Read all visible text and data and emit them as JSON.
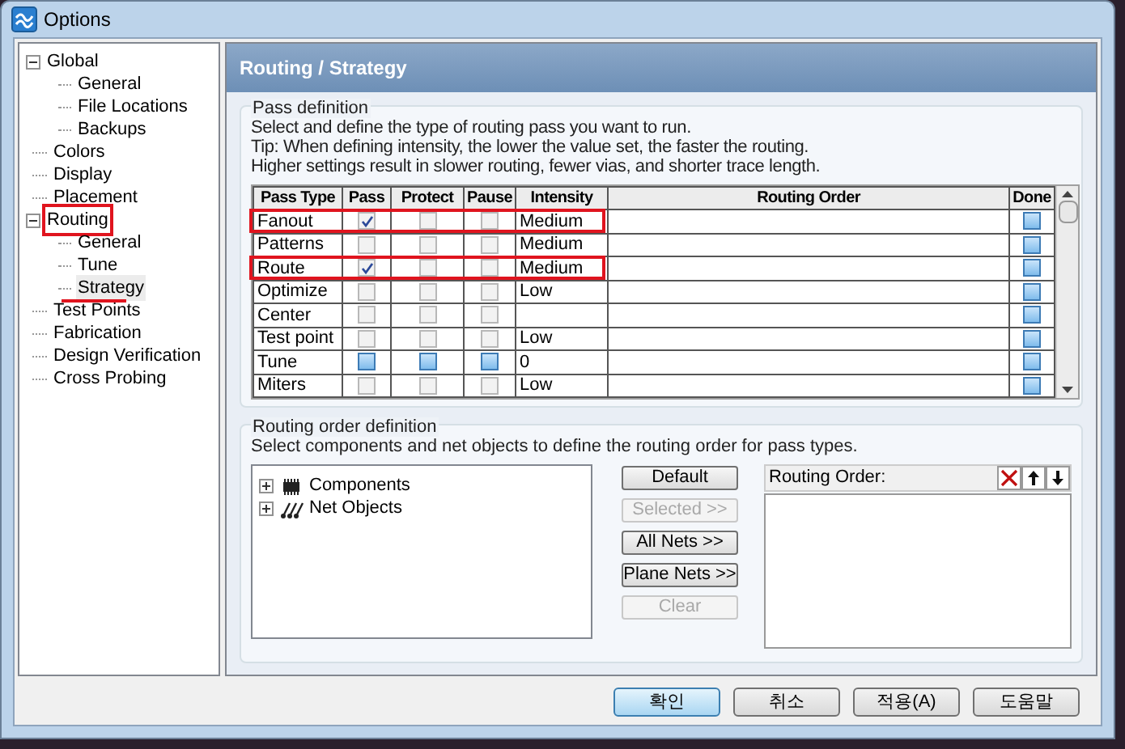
{
  "window": {
    "title": "Options"
  },
  "tree": [
    {
      "label": "Global",
      "expanded": true,
      "highlighted": false,
      "selected": false,
      "children": [
        {
          "label": "General",
          "selected": false
        },
        {
          "label": "File Locations",
          "selected": false
        },
        {
          "label": "Backups",
          "selected": false
        }
      ]
    },
    {
      "label": "Colors",
      "selected": false
    },
    {
      "label": "Display",
      "selected": false
    },
    {
      "label": "Placement",
      "selected": false
    },
    {
      "label": "Routing",
      "expanded": true,
      "highlighted": true,
      "selected": false,
      "children": [
        {
          "label": "General",
          "selected": false
        },
        {
          "label": "Tune",
          "selected": false
        },
        {
          "label": "Strategy",
          "selected": true,
          "underlined": true
        }
      ]
    },
    {
      "label": "Test Points",
      "selected": false
    },
    {
      "label": "Fabrication",
      "selected": false
    },
    {
      "label": "Design Verification",
      "selected": false
    },
    {
      "label": "Cross Probing",
      "selected": false
    }
  ],
  "panel": {
    "title": "Routing / Strategy",
    "pass_definition": {
      "legend": "Pass definition",
      "lines": [
        "Select and define the type of routing pass you want to run.",
        "Tip: When defining intensity, the lower the value set, the faster the routing.",
        "Higher settings result in slower routing, fewer vias, and shorter trace length."
      ],
      "columns": [
        "Pass Type",
        "Pass",
        "Protect",
        "Pause",
        "Intensity",
        "Routing Order",
        "Done"
      ],
      "rows": [
        {
          "pass_type": "Fanout",
          "pass": {
            "checked": true,
            "disabled": true
          },
          "protect": {
            "checked": false,
            "disabled": true
          },
          "pause": {
            "checked": false,
            "disabled": true
          },
          "intensity": "Medium",
          "done": {
            "checked": false,
            "disabled": false
          },
          "highlighted": true
        },
        {
          "pass_type": "Patterns",
          "pass": {
            "checked": false,
            "disabled": true
          },
          "protect": {
            "checked": false,
            "disabled": true
          },
          "pause": {
            "checked": false,
            "disabled": true
          },
          "intensity": "Medium",
          "done": {
            "checked": false,
            "disabled": false
          },
          "highlighted": false
        },
        {
          "pass_type": "Route",
          "pass": {
            "checked": true,
            "disabled": true
          },
          "protect": {
            "checked": false,
            "disabled": true
          },
          "pause": {
            "checked": false,
            "disabled": true
          },
          "intensity": "Medium",
          "done": {
            "checked": false,
            "disabled": false
          },
          "highlighted": true
        },
        {
          "pass_type": "Optimize",
          "pass": {
            "checked": false,
            "disabled": true
          },
          "protect": {
            "checked": false,
            "disabled": true
          },
          "pause": {
            "checked": false,
            "disabled": true
          },
          "intensity": "Low",
          "done": {
            "checked": false,
            "disabled": false
          },
          "highlighted": false
        },
        {
          "pass_type": "Center",
          "pass": {
            "checked": false,
            "disabled": true
          },
          "protect": {
            "checked": false,
            "disabled": true
          },
          "pause": {
            "checked": false,
            "disabled": true
          },
          "done": {
            "checked": false,
            "disabled": false
          },
          "highlighted": false
        },
        {
          "pass_type": "Test point",
          "pass": {
            "checked": false,
            "disabled": true
          },
          "protect": {
            "checked": false,
            "disabled": true
          },
          "pause": {
            "checked": false,
            "disabled": true
          },
          "intensity": "Low",
          "done": {
            "checked": false,
            "disabled": false
          },
          "highlighted": false
        },
        {
          "pass_type": "Tune",
          "pass": {
            "checked": false,
            "disabled": false
          },
          "protect": {
            "checked": false,
            "disabled": false
          },
          "pause": {
            "checked": false,
            "disabled": false
          },
          "intensity": "0",
          "done": {
            "checked": false,
            "disabled": false
          },
          "highlighted": false
        },
        {
          "pass_type": "Miters",
          "pass": {
            "checked": false,
            "disabled": true
          },
          "protect": {
            "checked": false,
            "disabled": true
          },
          "pause": {
            "checked": false,
            "disabled": true
          },
          "intensity": "Low",
          "done": {
            "checked": false,
            "disabled": false
          },
          "highlighted": false
        }
      ]
    },
    "routing_order_definition": {
      "legend": "Routing order definition",
      "description": "Select components and net objects to define the routing order for pass types.",
      "objects": [
        {
          "label": "Components",
          "kind": "components",
          "expanded": false
        },
        {
          "label": "Net Objects",
          "kind": "nets",
          "expanded": false
        }
      ],
      "buttons": [
        {
          "label": "Default",
          "disabled": false
        },
        {
          "label": "Selected >>",
          "disabled": true
        },
        {
          "label": "All Nets >>",
          "disabled": false
        },
        {
          "label": "Plane Nets >>",
          "disabled": false
        },
        {
          "label": "Clear",
          "disabled": true
        }
      ],
      "order_list": {
        "title": "Routing Order:"
      }
    }
  },
  "buttons": [
    {
      "label": "확인",
      "default": true
    },
    {
      "label": "취소",
      "default": false
    },
    {
      "label": "적용(A)",
      "default": false
    },
    {
      "label": "도움말",
      "default": false
    }
  ]
}
